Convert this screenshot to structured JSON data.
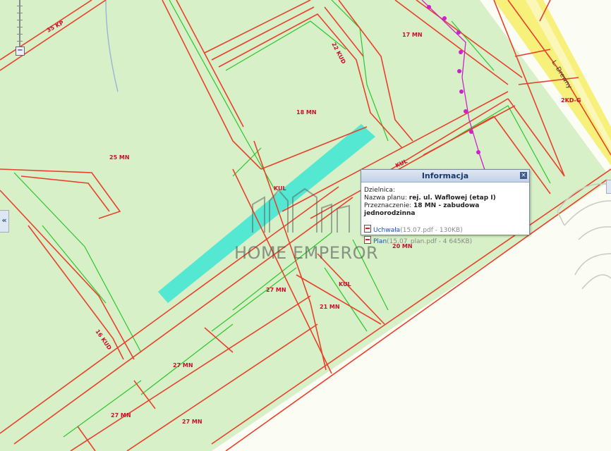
{
  "map": {
    "zones": [
      {
        "id": "35kp",
        "text": "35 KP"
      },
      {
        "id": "22kud",
        "text": "22 KUD"
      },
      {
        "id": "17mn",
        "text": "17 MN"
      },
      {
        "id": "18mn",
        "text": "18 MN"
      },
      {
        "id": "25mn",
        "text": "25 MN"
      },
      {
        "id": "kul1",
        "text": "KUL"
      },
      {
        "id": "kul2",
        "text": "KUL"
      },
      {
        "id": "kul3",
        "text": "KUL"
      },
      {
        "id": "20mn",
        "text": "20 MN"
      },
      {
        "id": "27mn1",
        "text": "27 MN"
      },
      {
        "id": "21mn",
        "text": "21 MN"
      },
      {
        "id": "16kud",
        "text": "16 KUD"
      },
      {
        "id": "27mn2",
        "text": "27 MN"
      },
      {
        "id": "27mn3",
        "text": "27 MN"
      },
      {
        "id": "27mn4",
        "text": "27 MN"
      },
      {
        "id": "2kdg",
        "text": "2KD-G"
      },
      {
        "id": "street",
        "text": "L. Drewny"
      }
    ],
    "colors": {
      "zone_fill": "#d7f0c7",
      "boundary": "#e8402a",
      "highlight": "#4de6d2",
      "road": "#f7f07a",
      "route": "#cc22cc",
      "building_line": "#2ec52e"
    }
  },
  "popup": {
    "title": "Informacja",
    "close_icon": "close-icon",
    "dzielnica_label": "Dzielnica:",
    "plan_name_label": "Nazwa planu:",
    "plan_name_value": "rej. ul. Waflowej (etap I)",
    "purpose_label": "Przeznaczenie:",
    "purpose_value": "18 MN - zabudowa jednorodzinna",
    "docs": [
      {
        "icon": "pdf-icon",
        "link": "Uchwała",
        "meta": "(15.07.pdf - 130KB)"
      },
      {
        "icon": "pdf-icon",
        "link": "Plan",
        "meta": "(15.07_plan.pdf - 4 645KB)"
      }
    ]
  },
  "controls": {
    "zoom_out_symbol": "−",
    "collapse_symbol": "«"
  },
  "watermark": "HOME EMPEROR"
}
